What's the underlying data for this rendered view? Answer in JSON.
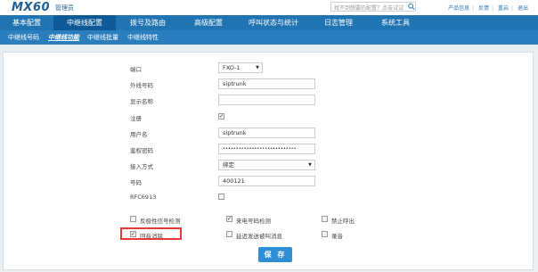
{
  "header": {
    "logo": "MX60",
    "role": "管理员",
    "search_placeholder": "找不到想要的配置？点击试试",
    "links": [
      "产品信息",
      "反馈",
      "重启",
      "退出"
    ]
  },
  "nav": {
    "items": [
      "基本配置",
      "中继线配置",
      "拨号及路由",
      "高级配置",
      "呼叫状态与统计",
      "日志管理",
      "系统工具"
    ],
    "active": "中继线配置"
  },
  "subnav": {
    "items": [
      "中继线号码",
      "中继线功能",
      "中继线批量",
      "中继线特性"
    ],
    "active": "中继线功能"
  },
  "form": {
    "port": {
      "label": "端口",
      "value": "FXO-1"
    },
    "outbound_number": {
      "label": "外线号码",
      "value": "siptrunk"
    },
    "display_name": {
      "label": "显示名称",
      "value": ""
    },
    "register": {
      "label": "注册",
      "checked": true
    },
    "username": {
      "label": "用户名",
      "value": "siptrunk"
    },
    "password": {
      "label": "鉴权密码",
      "value": "••••••••••••••••••••••••••••"
    },
    "access_mode": {
      "label": "接入方式",
      "value": "绑定"
    },
    "number": {
      "label": "号码",
      "value": "400121"
    },
    "rfc6913": {
      "label": "RFC6913",
      "checked": false
    }
  },
  "options": {
    "polarity_detect": {
      "label": "反极性信号检测",
      "checked": false
    },
    "caller_id_detect": {
      "label": "来电号码检测",
      "checked": true
    },
    "block_outbound": {
      "label": "禁止呼出",
      "checked": false
    },
    "echo_cancel": {
      "label": "回音消除",
      "checked": true
    },
    "delay_send": {
      "label": "延迟发送被叫消息",
      "checked": false
    },
    "record": {
      "label": "录音",
      "checked": false
    }
  },
  "save_label": "保 存",
  "accent": "#2174b2",
  "highlight_color": "#e23b3b"
}
